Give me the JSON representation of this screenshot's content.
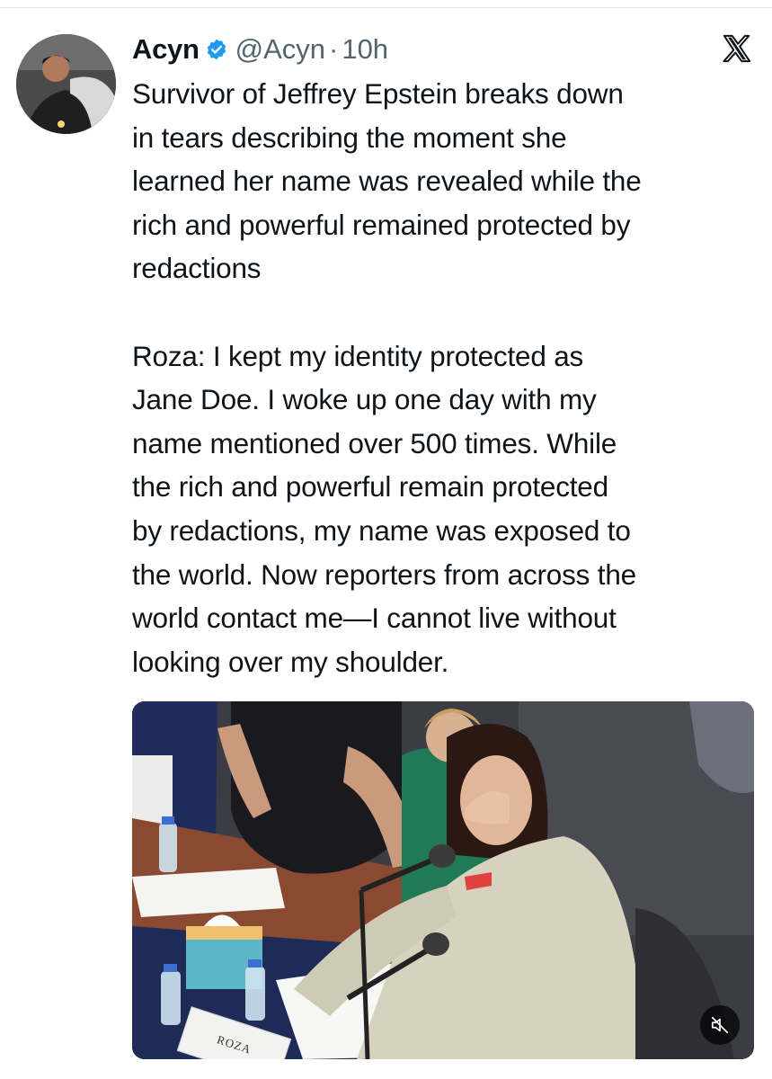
{
  "tweet": {
    "author": {
      "display_name": "Acyn",
      "handle": "@Acyn",
      "verified": true,
      "verified_color": "#1d9bf0"
    },
    "separator": "·",
    "timestamp": "10h",
    "platform_icon": "x-logo-icon",
    "text_paragraph_1": [
      "Survivor of Jeffrey Epstein breaks down",
      "in tears describing the moment she",
      "learned her name was revealed while the",
      "rich and powerful remained protected by",
      "redactions"
    ],
    "text_paragraph_2": [
      "Roza: I kept my identity protected as",
      "Jane Doe. I woke up one day with my",
      "name mentioned over 500 times. While",
      "the rich and powerful remain protected",
      "by redactions, my name was exposed to",
      "the world. Now reporters from across the",
      "world contact me—I cannot live without",
      "looking over my shoulder."
    ],
    "media": {
      "type": "video",
      "nameplate_text": "ROZA",
      "mute_icon": "speaker-muted-icon"
    }
  }
}
